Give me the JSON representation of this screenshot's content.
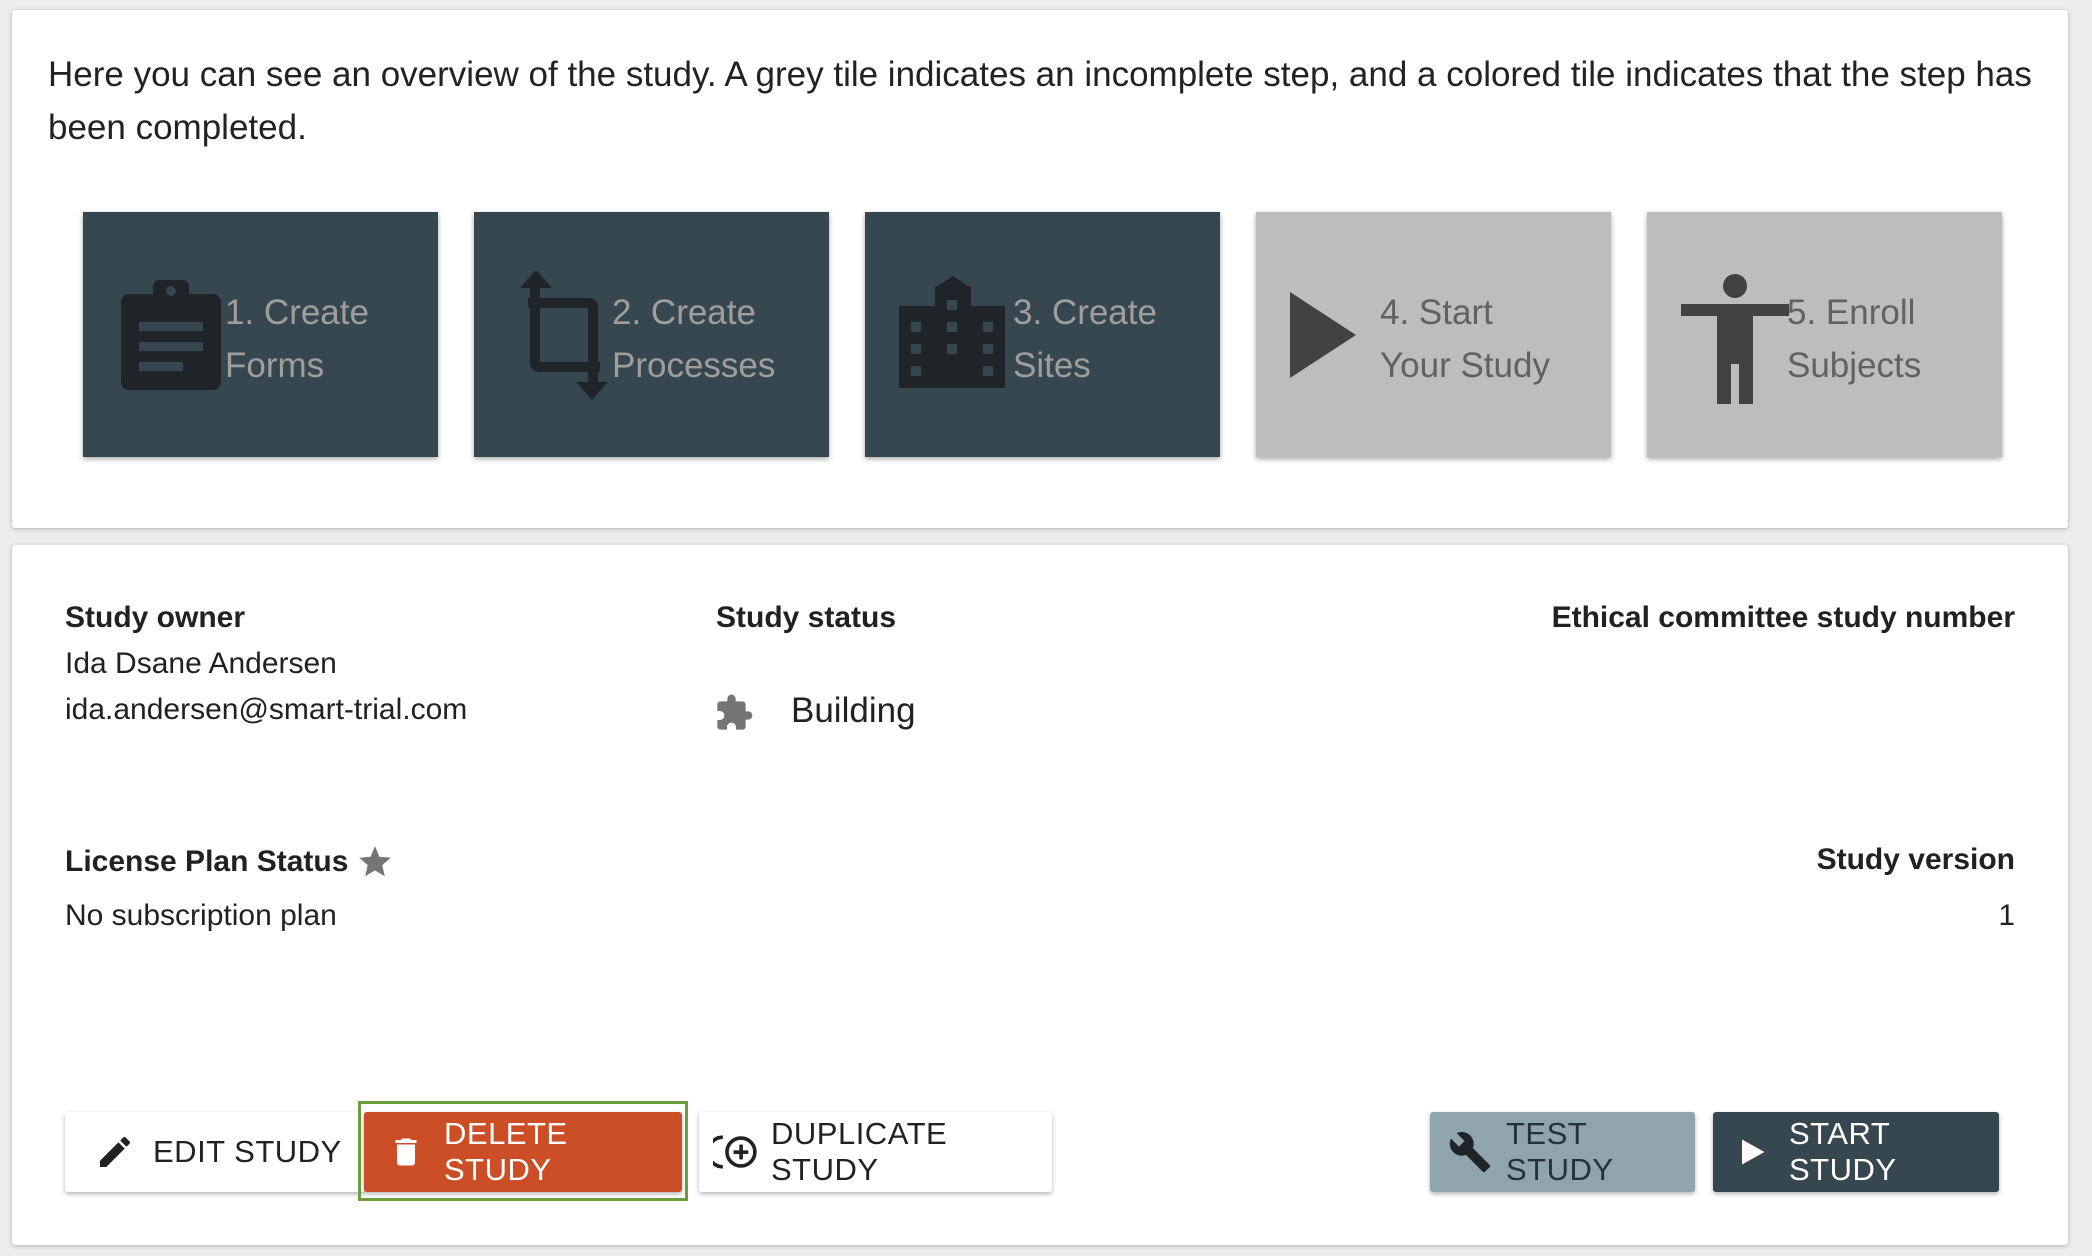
{
  "overview": {
    "intro": "Here you can see an overview of the study. A grey tile indicates an incomplete step, and a colored tile indicates that the step has been completed.",
    "tiles": [
      {
        "label": "1. Create\nForms",
        "icon": "clipboard-icon",
        "status": "completed"
      },
      {
        "label": "2. Create\nProcesses",
        "icon": "crop-rotate-icon",
        "status": "completed"
      },
      {
        "label": "3. Create\nSites",
        "icon": "building-icon",
        "status": "completed"
      },
      {
        "label": "4. Start\nYour Study",
        "icon": "play-icon",
        "status": "incomplete"
      },
      {
        "label": "5. Enroll\nSubjects",
        "icon": "person-icon",
        "status": "incomplete"
      }
    ]
  },
  "details": {
    "owner_label": "Study owner",
    "owner_name": "Ida Dsane Andersen",
    "owner_email": "ida.andersen@smart-trial.com",
    "status_label": "Study status",
    "status_icon": "puzzle-icon",
    "status_value": "Building",
    "ethics_label": "Ethical committee study number",
    "license_label": "License Plan Status",
    "license_icon": "star-icon",
    "license_value": "No subscription plan",
    "version_label": "Study version",
    "version_value": "1"
  },
  "actions": {
    "edit": "EDIT STUDY",
    "delete": "DELETE STUDY",
    "duplicate": "DUPLICATE STUDY",
    "test": "TEST STUDY",
    "start": "START STUDY"
  },
  "colors": {
    "completed_tile": "#37474f",
    "incomplete_tile": "#bdbdbd",
    "delete_button": "#cc4e27",
    "test_button": "#90a4ae",
    "start_button": "#37474f",
    "focus_outline": "#6a9f3f"
  }
}
